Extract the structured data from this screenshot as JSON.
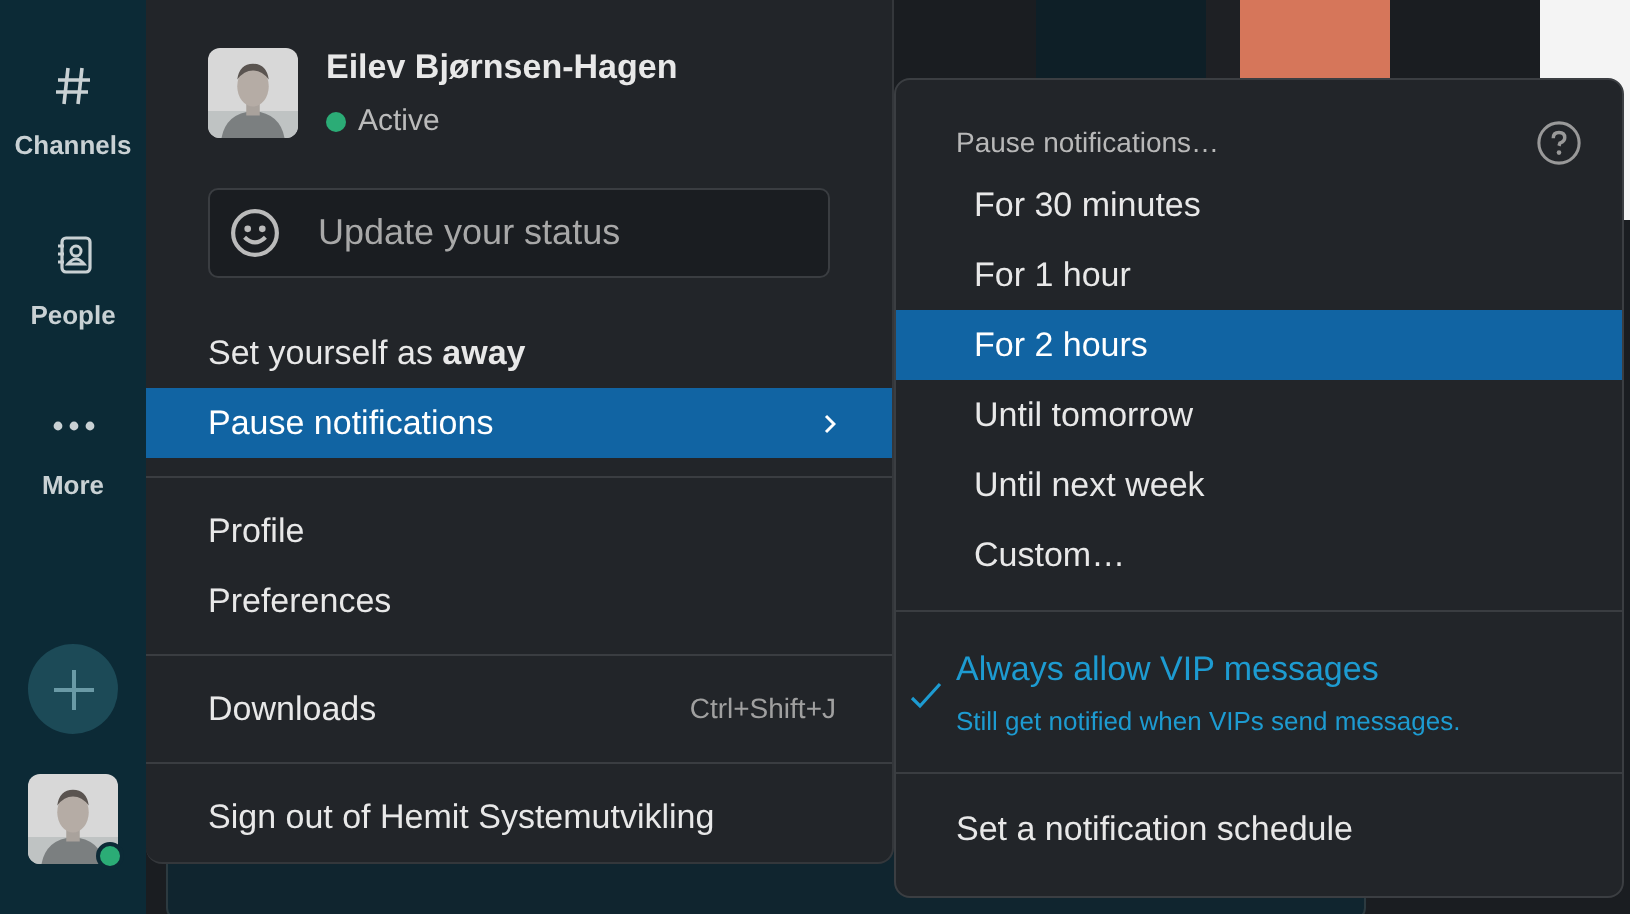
{
  "sidebar": {
    "items": [
      {
        "kind": "channels",
        "label": "Channels"
      },
      {
        "kind": "people",
        "label": "People"
      },
      {
        "kind": "more",
        "label": "More"
      }
    ],
    "user_online": true
  },
  "user": {
    "name": "Eilev Bjørnsen-Hagen",
    "status": "Active",
    "online": true
  },
  "status_field": {
    "placeholder": "Update your status"
  },
  "menu": {
    "sections": [
      [
        {
          "label": "Set yourself as **away**",
          "selected": false
        },
        {
          "label": "Pause notifications",
          "selected": true,
          "submenu": true
        }
      ],
      [
        {
          "label": "Profile",
          "selected": false
        },
        {
          "label": "Preferences",
          "selected": false
        }
      ],
      [
        {
          "label": "Downloads",
          "selected": false,
          "shortcut": "Ctrl+Shift+J"
        }
      ],
      [
        {
          "label": "Sign out of Hemit Systemutvikling",
          "selected": false
        }
      ]
    ]
  },
  "submenu": {
    "title": "Pause notifications…",
    "options": [
      {
        "label": "For 30 minutes",
        "selected": false
      },
      {
        "label": "For 1 hour",
        "selected": false
      },
      {
        "label": "For 2 hours",
        "selected": true
      },
      {
        "label": "Until tomorrow",
        "selected": false
      },
      {
        "label": "Until next week",
        "selected": false
      },
      {
        "label": "Custom…",
        "selected": false
      }
    ],
    "vip": {
      "label": "Always allow VIP messages",
      "description": "Still get notified when VIPs send messages.",
      "checked": true
    },
    "schedule": "Set a notification schedule"
  }
}
